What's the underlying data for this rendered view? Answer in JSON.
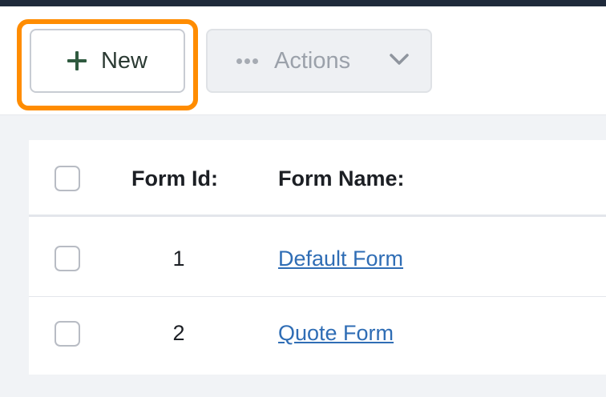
{
  "toolbar": {
    "new_label": "New",
    "actions_label": "Actions",
    "highlight_color": "#ff8c00"
  },
  "table": {
    "headers": {
      "id": "Form Id:",
      "name": "Form Name:"
    },
    "rows": [
      {
        "id": "1",
        "name": "Default Form"
      },
      {
        "id": "2",
        "name": "Quote Form"
      }
    ],
    "link_color": "#2f6db5"
  },
  "icons": {
    "new": "plus-icon",
    "actions": "more-dots-icon",
    "dropdown": "chevron-down-icon"
  }
}
